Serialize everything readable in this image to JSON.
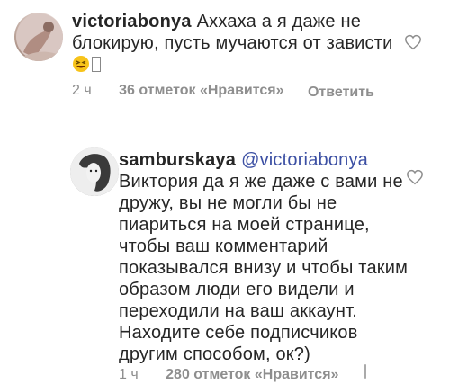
{
  "comments": [
    {
      "username": "victoriabonya",
      "text": "Аххаха а я даже не блокирую, пусть мучаются от зависти",
      "emoji": "grinning-squinting-face",
      "time": "2 ч",
      "likes": "36 отметок «Нравится»",
      "reply_label": "Ответить"
    },
    {
      "username": "samburskaya",
      "mention": "@victoriabonya",
      "text": "Виктория да я же даже с вами не дружу, вы не могли бы не пиариться на моей странице, чтобы ваш комментарий показывался внизу и чтобы таким образом люди его видели и переходили на ваш аккаунт. Находите себе подписчиков другим способом, ок?)",
      "time": "1 ч",
      "likes": "280 отметок «Нравится»"
    }
  ],
  "colors": {
    "text": "#262626",
    "meta": "#8e8e8e",
    "mention": "#3b4fa3"
  }
}
